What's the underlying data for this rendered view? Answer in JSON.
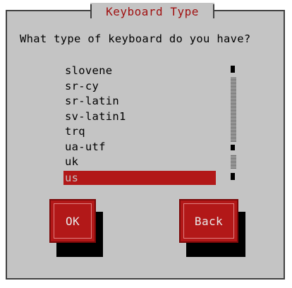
{
  "dialog": {
    "title": "Keyboard Type",
    "question": "What type of keyboard do you have?"
  },
  "keyboard_list": {
    "items": [
      "slovene",
      "sr-cy",
      "sr-latin",
      "sv-latin1",
      "trq",
      "ua-utf",
      "uk",
      "us"
    ],
    "selected": "us"
  },
  "buttons": {
    "ok_label": "OK",
    "back_label": "Back"
  },
  "colors": {
    "accent_red": "#b21818",
    "dialog_gray": "#c4c4c4",
    "title_red": "#a01010"
  }
}
